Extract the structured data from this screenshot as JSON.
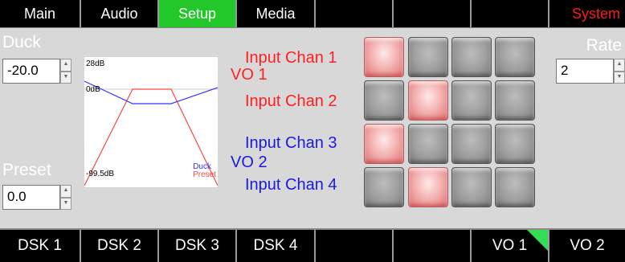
{
  "top_tabs": [
    {
      "label": "Main"
    },
    {
      "label": "Audio"
    },
    {
      "label": "Setup",
      "active": true
    },
    {
      "label": "Media"
    },
    {
      "label": ""
    },
    {
      "label": ""
    },
    {
      "label": ""
    },
    {
      "label": "System",
      "color": "#ff1a1a"
    }
  ],
  "bottom_tabs": [
    {
      "label": "DSK 1"
    },
    {
      "label": "DSK 2"
    },
    {
      "label": "DSK 3"
    },
    {
      "label": "DSK 4"
    },
    {
      "label": ""
    },
    {
      "label": ""
    },
    {
      "label": "VO 1",
      "indicator": true
    },
    {
      "label": "VO 2"
    }
  ],
  "duck": {
    "label": "Duck",
    "value": "-20.0"
  },
  "preset": {
    "label": "Preset",
    "value": "0.0"
  },
  "rate": {
    "label": "Rate",
    "value": "2"
  },
  "graph": {
    "top_label": "28dB",
    "mid_label": "0dB",
    "bottom_label": "-99.5dB",
    "legend_duck": "Duck",
    "legend_preset": "Preset",
    "duck_color": "#3333ff",
    "preset_color": "#ff4444"
  },
  "groups": [
    {
      "label": "VO 1",
      "color": "#ff2020"
    },
    {
      "label": "VO 2",
      "color": "#1a1adf"
    }
  ],
  "channels": [
    {
      "label": "Input Chan 1",
      "color": "#ff2020"
    },
    {
      "label": "Input Chan 2",
      "color": "#ff2020"
    },
    {
      "label": "Input Chan 3",
      "color": "#1a1adf"
    },
    {
      "label": "Input Chan 4",
      "color": "#1a1adf"
    }
  ],
  "matrix": [
    [
      true,
      false,
      false,
      false
    ],
    [
      false,
      true,
      false,
      false
    ],
    [
      true,
      false,
      false,
      false
    ],
    [
      false,
      true,
      false,
      false
    ]
  ]
}
